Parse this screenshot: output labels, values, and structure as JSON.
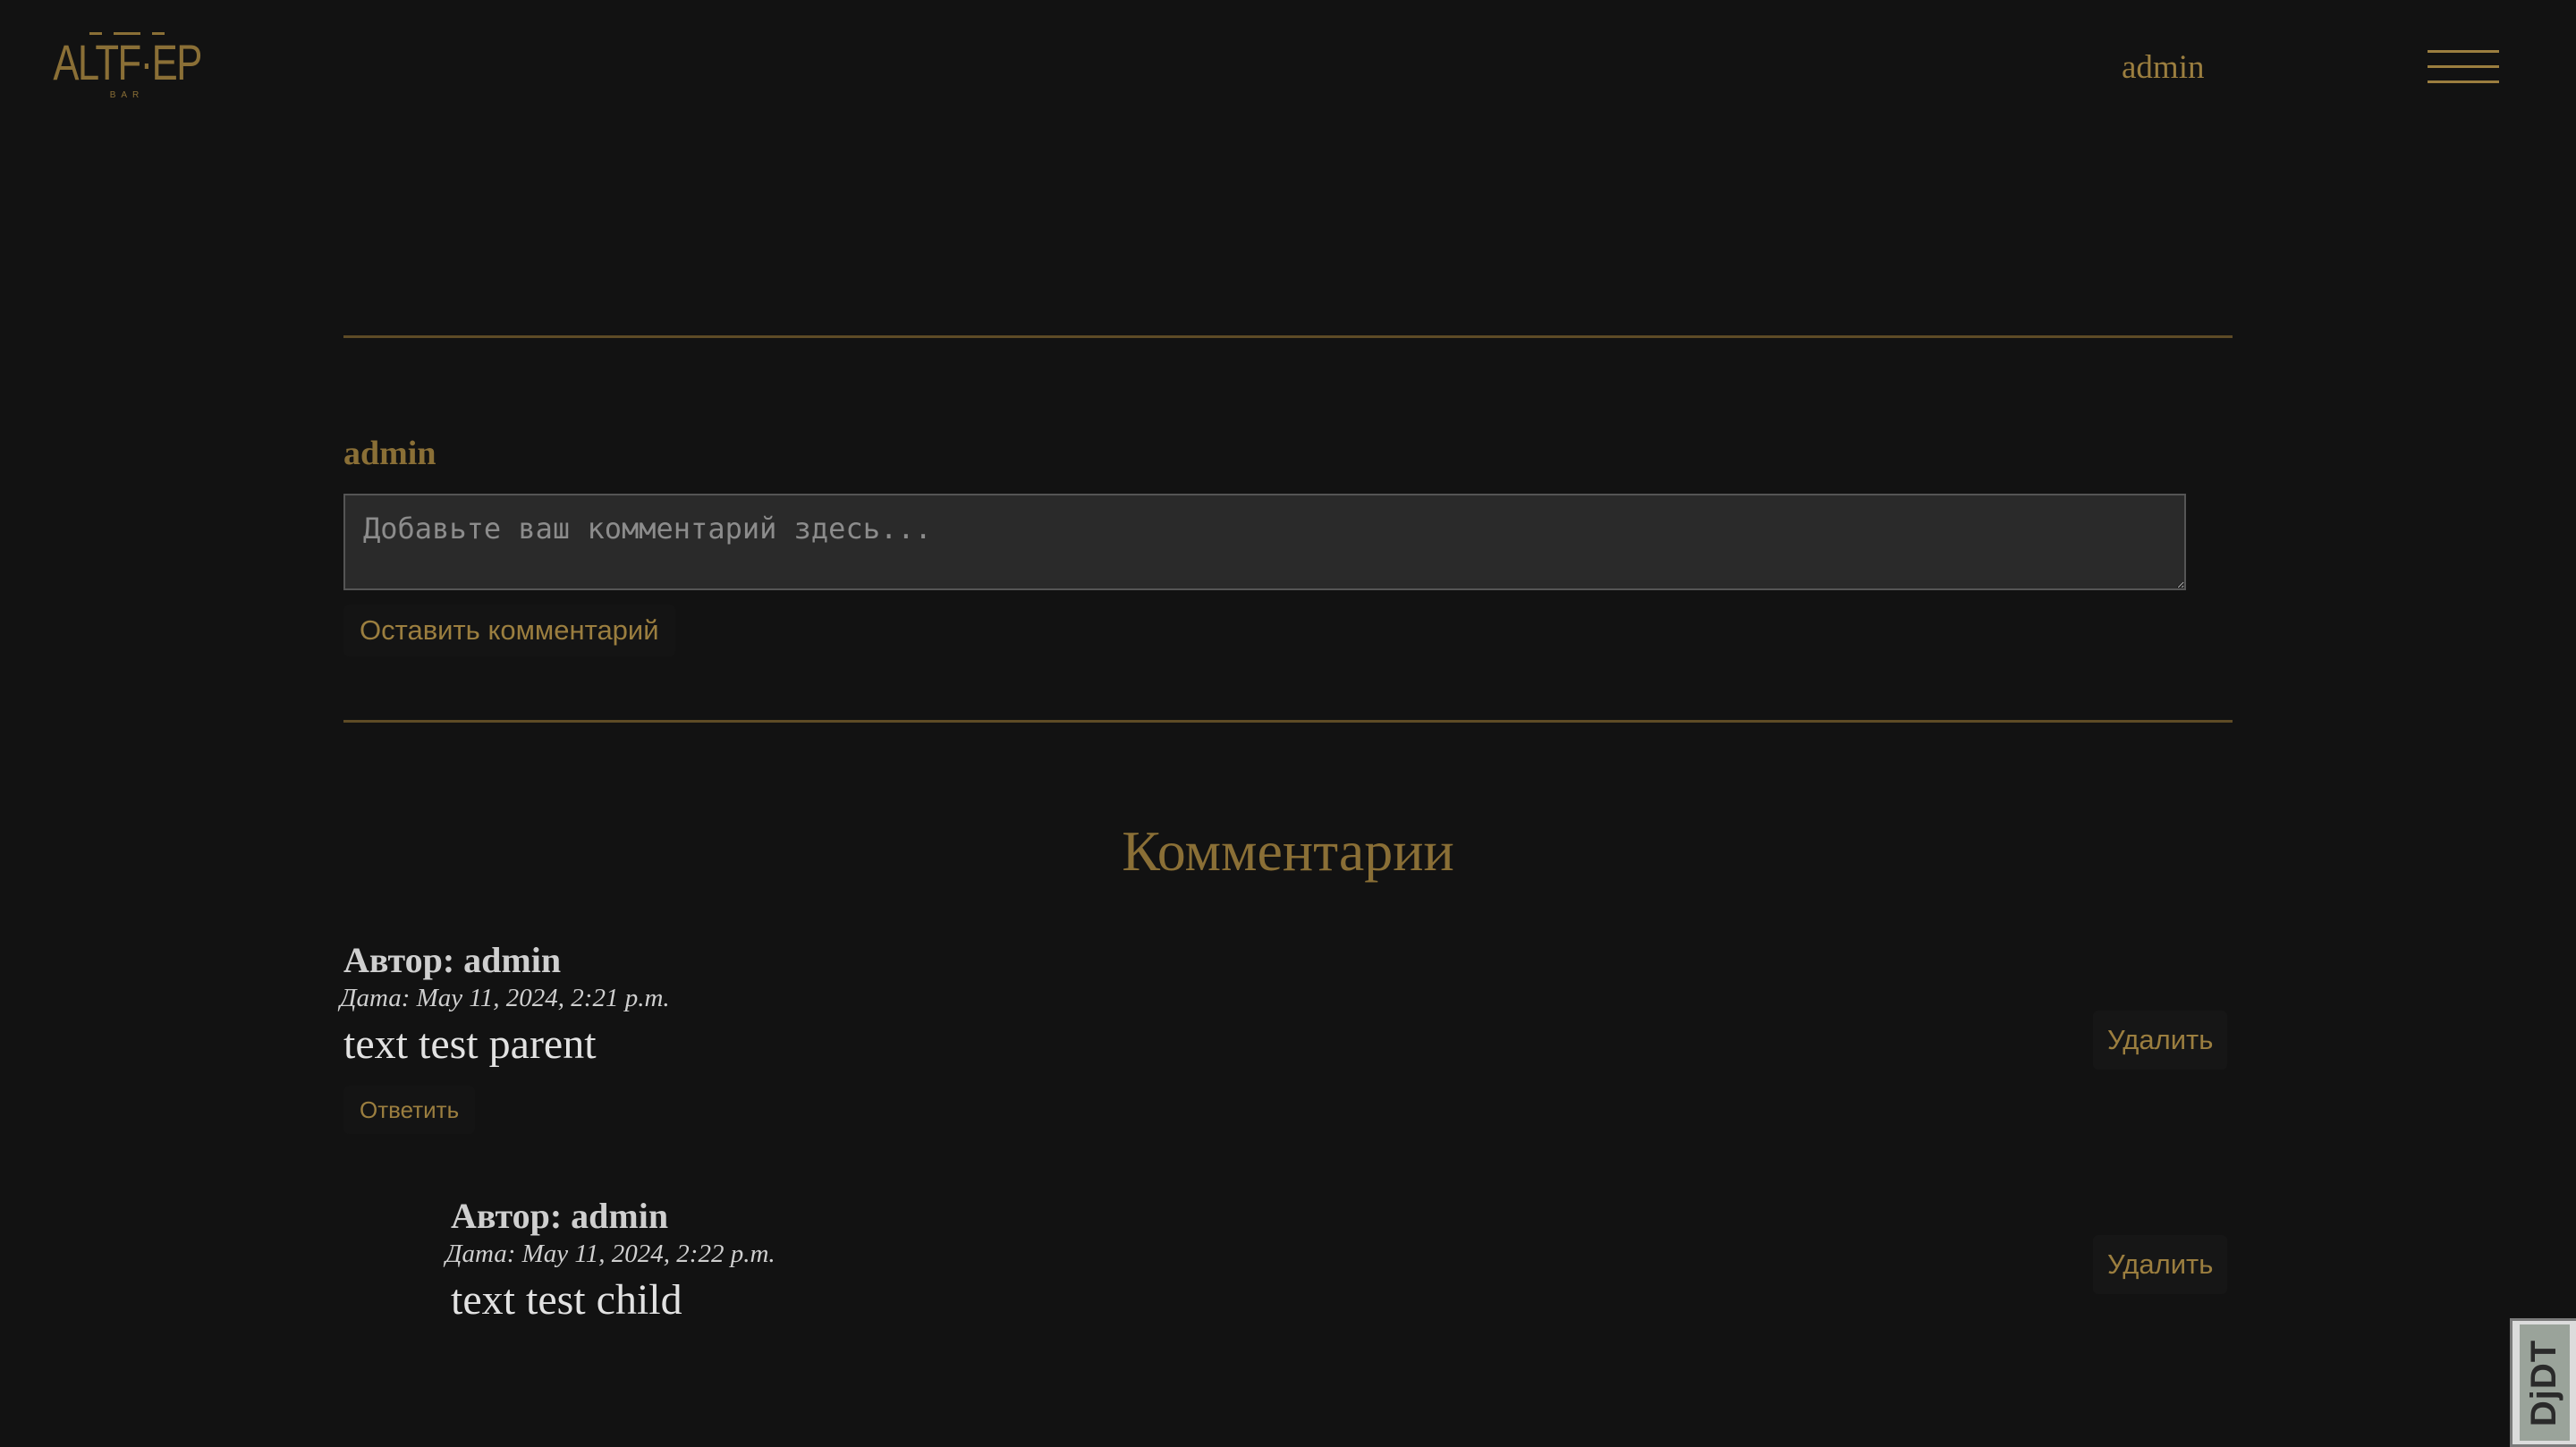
{
  "header": {
    "logo_text": "ALTF·EP",
    "logo_subtext": "BAR",
    "user_label": "admin",
    "menu_icon": "hamburger-menu-icon"
  },
  "comment_form": {
    "username": "admin",
    "placeholder": "Добавьте ваш комментарий здесь...",
    "value": "",
    "submit_label": "Оставить комментарий"
  },
  "comments_section": {
    "title": "Комментарии",
    "comments": [
      {
        "author": "Автор: admin",
        "date": "Дата: May 11, 2024, 2:21 p.m.",
        "text": "text test parent",
        "reply_label": "Ответить",
        "delete_label": "Удалить"
      },
      {
        "author": "Автор: admin",
        "date": "Дата: May 11, 2024, 2:22 p.m.",
        "text": "text test child",
        "delete_label": "Удалить"
      }
    ]
  },
  "debug_toolbar": {
    "label": "DjDT"
  },
  "colors": {
    "background": "#121212",
    "accent_gold": "#9b7e3f",
    "text_light": "#e2e2e2"
  }
}
